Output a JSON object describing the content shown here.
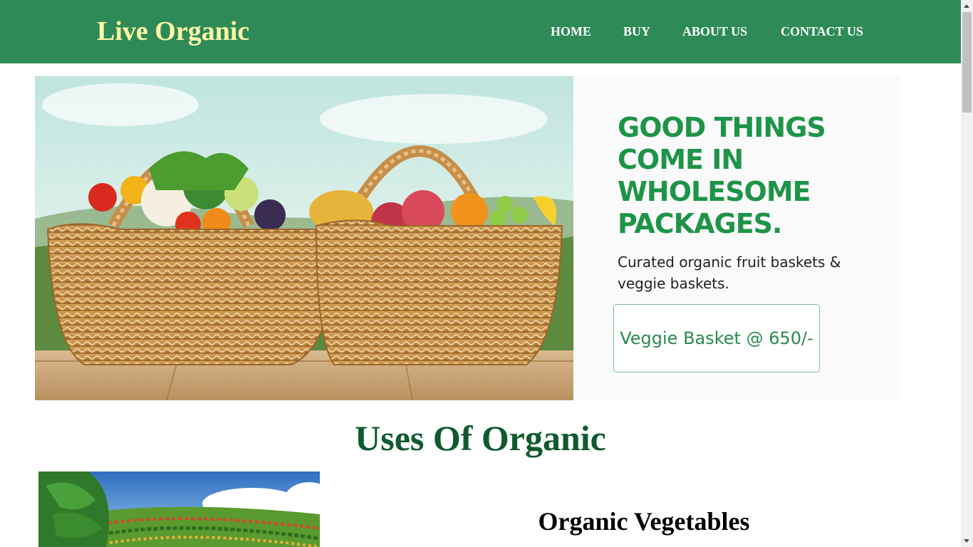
{
  "brand": "Live Organic",
  "nav": {
    "home": "HOME",
    "buy": "BUY",
    "about": "ABOUT US",
    "contact": "CONTACT US"
  },
  "banner": {
    "headline": "GOOD THINGS COME IN WHOLESOME PACKAGES.",
    "subline": "Curated organic fruit baskets & veggie baskets.",
    "cta": "Veggie Basket @ 650/-"
  },
  "section": {
    "title": "Uses Of Organic",
    "items": [
      {
        "title": "Organic Vegetables"
      }
    ]
  },
  "colors": {
    "nav_bg": "#2e8b57",
    "brand": "#fff7a8",
    "headline": "#1e9448",
    "section_title": "#0f5a2e"
  }
}
